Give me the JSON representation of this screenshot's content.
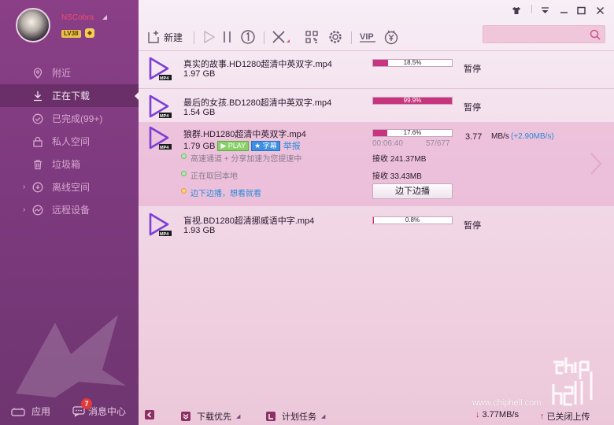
{
  "user": {
    "name": "NSCobra",
    "level": "LV38"
  },
  "nav": [
    {
      "label": "附近",
      "icon": "location-icon"
    },
    {
      "label": "正在下载",
      "icon": "download-icon"
    },
    {
      "label": "已完成(99+)",
      "icon": "check-circle-icon"
    },
    {
      "label": "私人空间",
      "icon": "lock-icon"
    },
    {
      "label": "垃圾箱",
      "icon": "trash-icon"
    },
    {
      "label": "离线空间",
      "icon": "cloud-icon"
    },
    {
      "label": "远程设备",
      "icon": "remote-device-icon"
    }
  ],
  "sidebar_bottom": {
    "apps_label": "应用",
    "messages_label": "消息中心",
    "messages_badge": "7"
  },
  "toolbar": {
    "new_label": "新建"
  },
  "search": {
    "placeholder": ""
  },
  "downloads": [
    {
      "name": "真实的故事.HD1280超清中英双字.mp4",
      "size": "1.97 GB",
      "progress_text": "18.5%",
      "progress": 18.5,
      "status": "暂停"
    },
    {
      "name": "最后的女孩.BD1280超清中英双字.mp4",
      "size": "1.54 GB",
      "progress_text": "99.9%",
      "progress": 99.9,
      "status": "暂停"
    },
    {
      "name": "狼群.HD1280超清中英双字.mp4",
      "size": "1.79 GB",
      "progress_text": "17.6%",
      "progress": 17.6,
      "elapsed": "00:06:40",
      "pieces": "57/677",
      "speed": "3.77",
      "speed_unit": "MB/s",
      "speed_extra": "(+2.90MB/s)",
      "tag_play": "PLAY",
      "tag_sub": "字幕",
      "report": "举报",
      "line1": "高速通道 + 分享加速为您提速中",
      "line2": "正在取回本地",
      "line3": "边下边播，想看就看",
      "recv1": "接收 241.37MB",
      "recv2": "接收 33.43MB",
      "play_btn": "边下边播"
    },
    {
      "name": "盲视.BD1280超清挪威语中字.mp4",
      "size": "1.93 GB",
      "progress_text": "0.8%",
      "progress": 0.8,
      "status": "暂停"
    }
  ],
  "bottom": {
    "priority_label": "下载优先",
    "schedule_label": "计划任务",
    "down_speed": "3.77MB/s",
    "upload_status": "已关闭上传"
  },
  "watermark": {
    "site": "www.chiphell.com"
  },
  "colors": {
    "sidebar": "#7d3a7e",
    "accent": "#c8357f",
    "link": "#2a8ad8"
  }
}
